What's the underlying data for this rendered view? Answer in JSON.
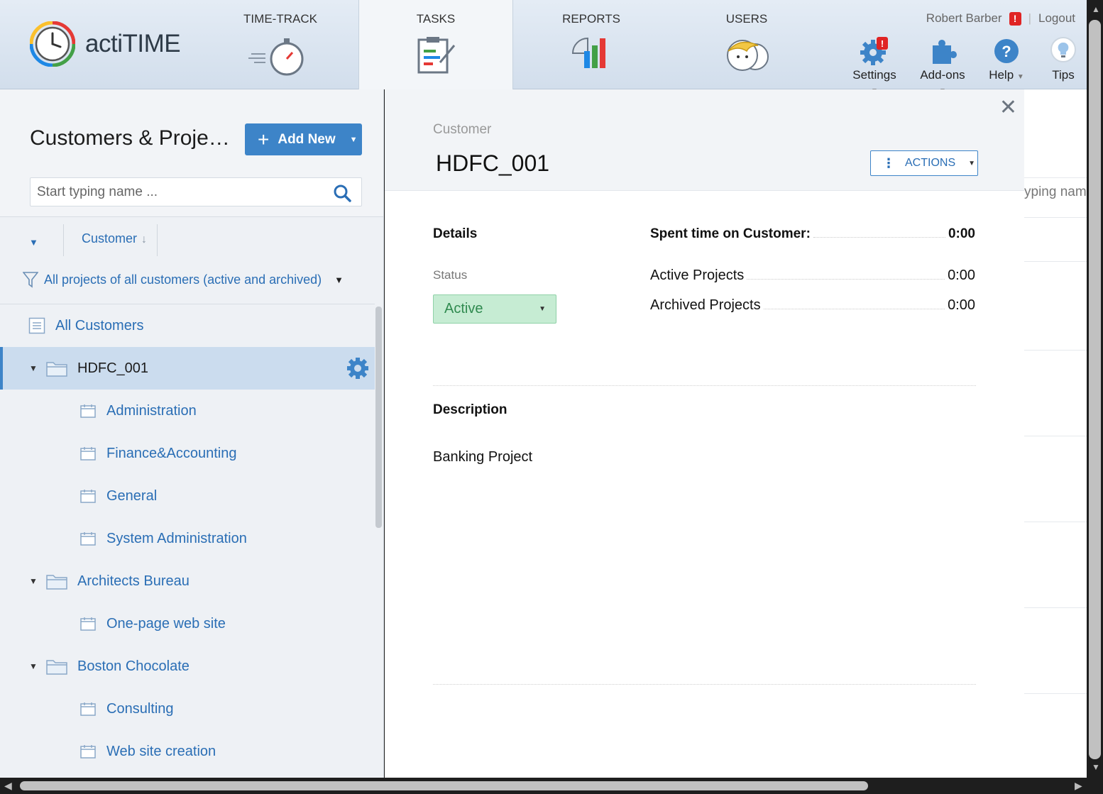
{
  "app": {
    "name": "actiTIME"
  },
  "nav": {
    "tabs": [
      {
        "label": "TIME-TRACK",
        "icon": "stopwatch-icon"
      },
      {
        "label": "TASKS",
        "icon": "clipboard-icon",
        "active": true
      },
      {
        "label": "REPORTS",
        "icon": "chart-icon"
      },
      {
        "label": "USERS",
        "icon": "users-icon"
      }
    ]
  },
  "user": {
    "name": "Robert Barber",
    "alert": "!",
    "separator": "|",
    "logout": "Logout"
  },
  "tools": {
    "settings": "Settings",
    "addons": "Add-ons",
    "help": "Help",
    "tips": "Tips",
    "settings_badge": "!"
  },
  "left": {
    "title": "Customers & Proje…",
    "add_new": "Add New",
    "search_placeholder": "Start typing name ...",
    "sort_label": "Customer",
    "filter_label": "All projects of all customers (active and archived)",
    "all_customers": "All Customers",
    "customers": [
      {
        "name": "HDFC_001",
        "selected": true,
        "projects": [
          "Administration",
          "Finance&Accounting",
          "General",
          "System Administration"
        ]
      },
      {
        "name": "Architects Bureau",
        "projects": [
          "One-page web site"
        ]
      },
      {
        "name": "Boston Chocolate",
        "projects": [
          "Consulting",
          "Web site creation"
        ]
      }
    ]
  },
  "detail": {
    "type_label": "Customer",
    "name": "HDFC_001",
    "actions_label": "ACTIONS",
    "details_title": "Details",
    "status_label": "Status",
    "status_value": "Active",
    "spent_title": "Spent time on Customer:",
    "spent_value": "0:00",
    "active_projects_label": "Active Projects",
    "active_projects_value": "0:00",
    "archived_projects_label": "Archived Projects",
    "archived_projects_value": "0:00",
    "description_title": "Description",
    "description_text": "Banking Project"
  },
  "background": {
    "search_fragment": "yping nam"
  },
  "colors": {
    "accent": "#3d84c8",
    "status_active_bg": "#c6ecd3",
    "selected_row": "#cbdcee"
  }
}
